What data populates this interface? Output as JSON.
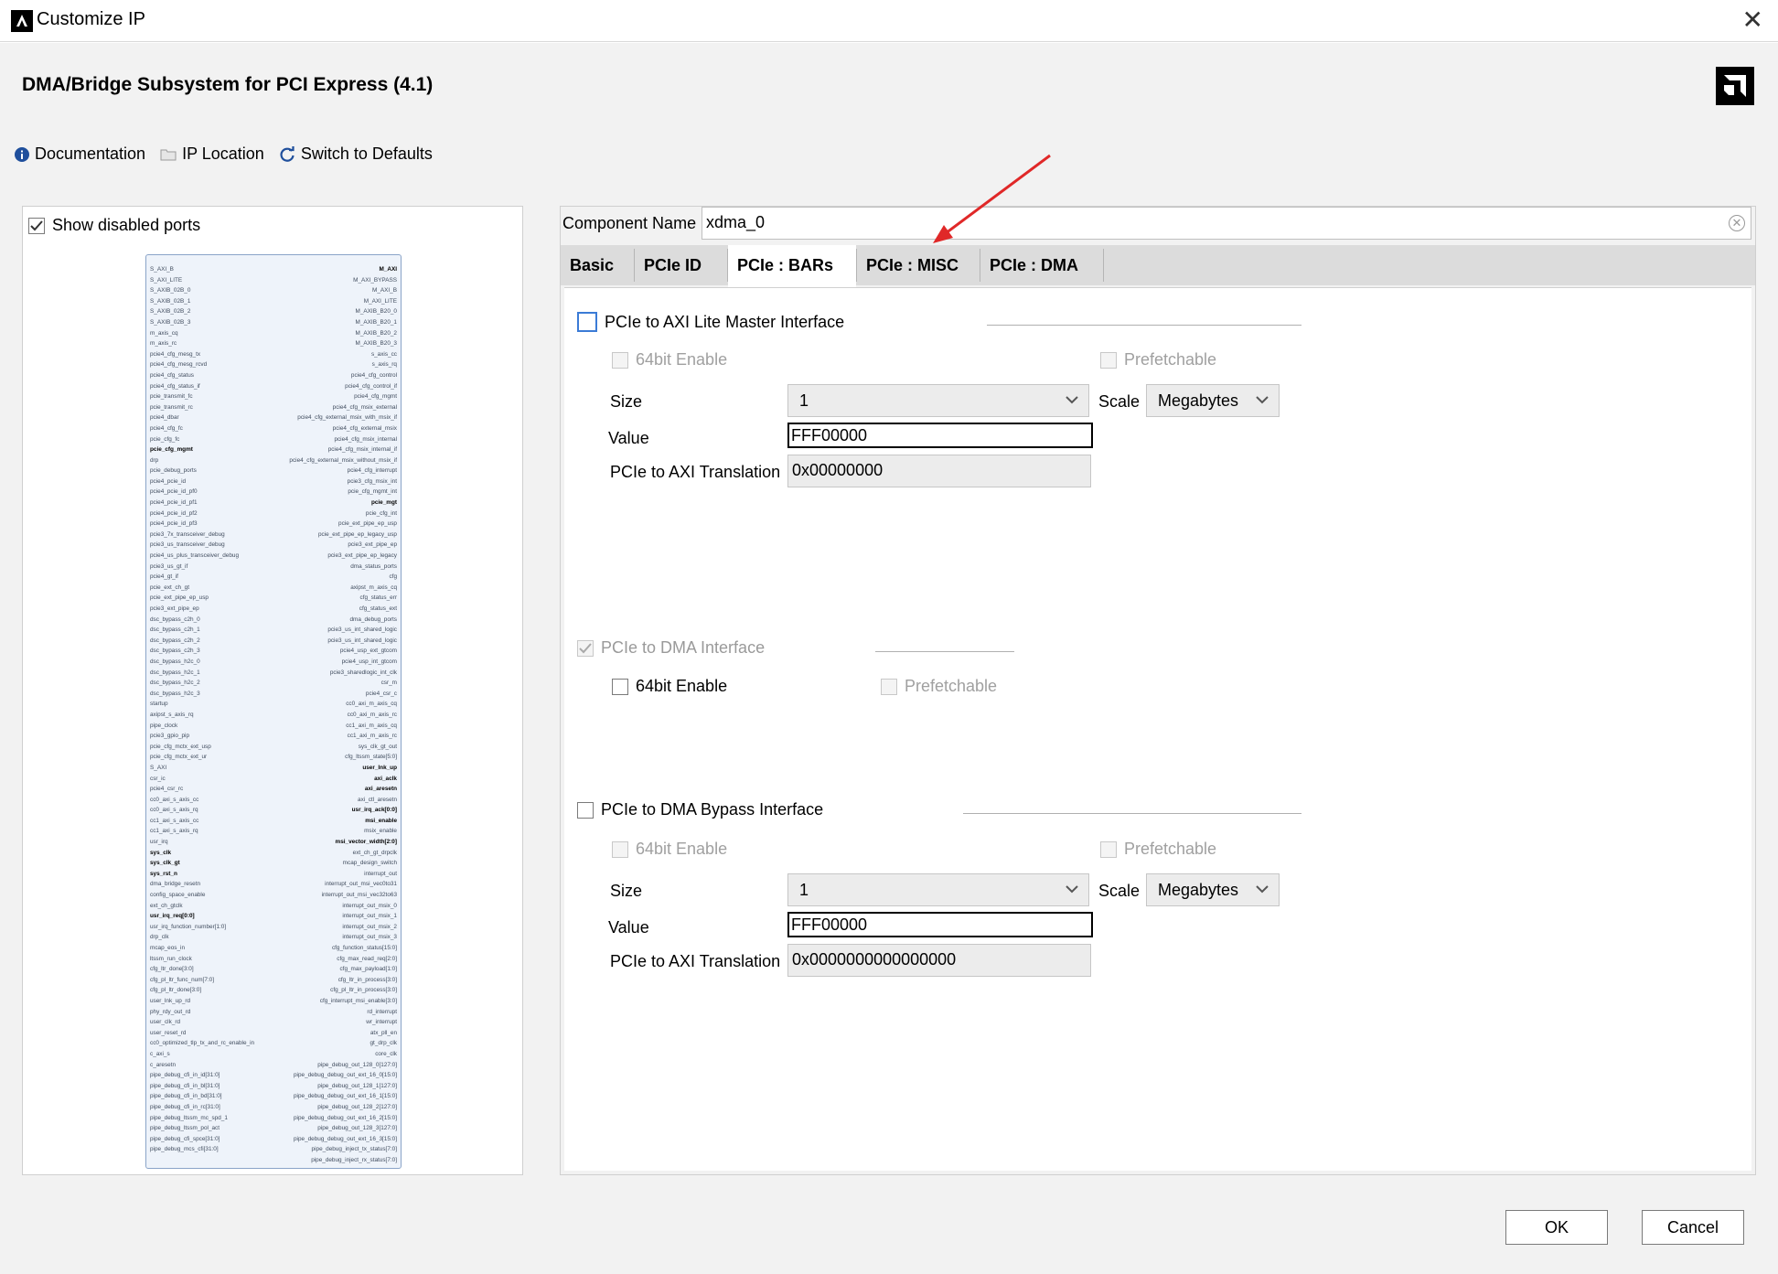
{
  "window": {
    "title": "Customize IP"
  },
  "header": {
    "ip_title": "DMA/Bridge Subsystem for PCI Express (4.1)",
    "toolbar": {
      "documentation": "Documentation",
      "ip_location": "IP Location",
      "switch_defaults": "Switch to Defaults"
    }
  },
  "left_panel": {
    "show_disabled_label": "Show disabled ports",
    "show_disabled_checked": true,
    "left_ports": [
      "S_AXI_B",
      "S_AXI_LITE",
      "S_AXIB_02B_0",
      "S_AXIB_02B_1",
      "S_AXIB_02B_2",
      "S_AXIB_02B_3",
      "m_axis_cq",
      "m_axis_rc",
      "pcie4_cfg_mesg_tx",
      "pcie4_cfg_mesg_rcvd",
      "pcie4_cfg_status",
      "pcie4_cfg_status_if",
      "pcie_transmit_fc",
      "pcie_transmit_rc",
      "pcie4_dbar",
      "pcie4_cfg_fc",
      "pcie_cfg_fc",
      "pcie_cfg_mgmt",
      "drp",
      "pcie_debug_ports",
      "pcie4_pcie_id",
      "pcie4_pcie_id_pf0",
      "pcie4_pcie_id_pf1",
      "pcie4_pcie_id_pf2",
      "pcie4_pcie_id_pf3",
      "pcie3_7x_transceiver_debug",
      "pcie3_us_transceiver_debug",
      "pcie4_us_plus_transceiver_debug",
      "pcie3_us_gt_if",
      "pcie4_gt_if",
      "pcie_ext_ch_gt",
      "pcie_ext_pipe_ep_usp",
      "pcie3_ext_pipe_ep",
      "dsc_bypass_c2h_0",
      "dsc_bypass_c2h_1",
      "dsc_bypass_c2h_2",
      "dsc_bypass_c2h_3",
      "dsc_bypass_h2c_0",
      "dsc_bypass_h2c_1",
      "dsc_bypass_h2c_2",
      "dsc_bypass_h2c_3",
      "startup",
      "axipst_s_axis_rq",
      "pipe_clock",
      "pcie3_gpio_pip",
      "pcie_cfg_mctx_ext_usp",
      "pcie_cfg_mctx_ext_ur",
      "S_AXI",
      "csr_ic",
      "pcie4_csr_rc",
      "cc0_axi_s_axis_cc",
      "cc0_axi_s_axis_rq",
      "cc1_axi_s_axis_cc",
      "cc1_axi_s_axis_rq",
      "usr_irq",
      "sys_clk",
      "sys_clk_gt",
      "sys_rst_n",
      "dma_bridge_resetn",
      "config_space_enable",
      "ext_ch_gtclk",
      "usr_irq_req[0:0]",
      "usr_irq_function_number[1:0]",
      "drp_clk",
      "mcap_eos_in",
      "ltssm_run_clock",
      "cfg_ltr_done[3:0]",
      "cfg_pl_ltr_func_num[7:0]",
      "cfg_pl_ltr_done[3:0]",
      "user_lnk_up_rd",
      "phy_rdy_out_rd",
      "user_clk_rd",
      "user_reset_rd",
      "cc0_optimized_tlp_tx_and_rc_enable_in",
      "c_axi_s",
      "c_aresetn",
      "pipe_debug_cfi_in_id[31:0]",
      "pipe_debug_cfi_in_bl[31:0]",
      "pipe_debug_cfi_in_bd[31:0]",
      "pipe_debug_cfi_in_rc[31:0]",
      "pipe_debug_ltssm_mc_spd_1",
      "pipe_debug_ltssm_pol_act",
      "pipe_debug_cfi_spce[31:0]",
      "pipe_debug_mcs_cfi[31:0]"
    ],
    "right_ports": [
      "M_AXI",
      "M_AXI_BYPASS",
      "M_AXI_B",
      "M_AXI_LITE",
      "M_AXIB_B20_0",
      "M_AXIB_B20_1",
      "M_AXIB_B20_2",
      "M_AXIB_B20_3",
      "s_axis_cc",
      "s_axis_rq",
      "pcie4_cfg_control",
      "pcie4_cfg_control_if",
      "pcie4_cfg_mgmt",
      "pcie4_cfg_msix_external",
      "pcie4_cfg_external_msix_with_msix_if",
      "pcie4_cfg_external_msix",
      "pcie4_cfg_msix_internal",
      "pcie4_cfg_msix_internal_if",
      "pcie4_cfg_external_msix_without_msix_if",
      "pcie4_cfg_interrupt",
      "pcie3_cfg_msix_int",
      "pcie_cfg_mgmt_int",
      "pcie_mgt",
      "pcie_cfg_int",
      "pcie_ext_pipe_ep_usp",
      "pcie_ext_pipe_ep_legacy_usp",
      "pcie3_ext_pipe_ep",
      "pcie3_ext_pipe_ep_legacy",
      "dma_status_ports",
      "cfg",
      "axipst_m_axis_cq",
      "cfg_status_err",
      "cfg_status_ext",
      "dma_debug_ports",
      "pcie3_us_int_shared_logic",
      "pcie3_us_int_shared_logic",
      "pcie4_usp_ext_gtcom",
      "pcie4_usp_int_gtcom",
      "pcie3_sharedlogic_int_clk",
      "csr_m",
      "pcie4_csr_c",
      "cc0_axi_m_axis_cq",
      "cc0_axi_m_axis_rc",
      "cc1_axi_m_axis_cq",
      "cc1_axi_m_axis_rc",
      "sys_clk_gt_out",
      "cfg_ltssm_state[5:0]",
      "user_lnk_up",
      "axi_aclk",
      "axi_aresetn",
      "axi_ctl_aresetn",
      "usr_irq_ack[0:0]",
      "msi_enable",
      "msix_enable",
      "msi_vector_width[2:0]",
      "ext_ch_gt_drpclk",
      "mcap_design_switch",
      "interrupt_out",
      "interrupt_out_msi_vec0to31",
      "interrupt_out_msi_vec32to63",
      "interrupt_out_msix_0",
      "interrupt_out_msix_1",
      "interrupt_out_msix_2",
      "interrupt_out_msix_3",
      "cfg_function_status[15:0]",
      "cfg_max_read_req[2:0]",
      "cfg_max_payload[1:0]",
      "cfg_ltr_in_process[3:0]",
      "cfg_pl_ltr_in_process[3:0]",
      "cfg_interrupt_msi_enable[3:0]",
      "rd_interrupt",
      "wr_interrupt",
      "atx_pll_en",
      "gt_drp_clk",
      "core_clk",
      "pipe_debug_out_128_0[127:0]",
      "pipe_debug_debug_out_ext_16_0[15:0]",
      "pipe_debug_out_128_1[127:0]",
      "pipe_debug_debug_out_ext_16_1[15:0]",
      "pipe_debug_out_128_2[127:0]",
      "pipe_debug_debug_out_ext_16_2[15:0]",
      "pipe_debug_out_128_3[127:0]",
      "pipe_debug_debug_out_ext_16_3[15:0]",
      "pipe_debug_inject_tx_status[7:0]",
      "pipe_debug_inject_rx_status[7:0]"
    ],
    "bold_ports": [
      "pcie_cfg_mgmt",
      "sys_clk",
      "sys_clk_gt",
      "sys_rst_n",
      "usr_irq_req[0:0]",
      "M_AXI",
      "pcie_mgt",
      "user_lnk_up",
      "axi_aclk",
      "axi_aresetn",
      "usr_irq_ack[0:0]",
      "msi_enable",
      "msi_vector_width[2:0]"
    ]
  },
  "component": {
    "label": "Component Name",
    "value": "xdma_0"
  },
  "tabs": [
    {
      "label": "Basic",
      "active": false
    },
    {
      "label": "PCIe ID",
      "active": false
    },
    {
      "label": "PCIe : BARs",
      "active": true
    },
    {
      "label": "PCIe : MISC",
      "active": false
    },
    {
      "label": "PCIe : DMA",
      "active": false
    }
  ],
  "sections": {
    "axi_lite": {
      "title": "PCIe to AXI Lite Master Interface",
      "checked": false,
      "enable_64bit": "64bit Enable",
      "prefetchable": "Prefetchable",
      "size_label": "Size",
      "size_value": "1",
      "scale_label": "Scale",
      "scale_value": "Megabytes",
      "value_label": "Value",
      "value": "FFF00000",
      "translation_label": "PCIe to AXI Translation",
      "translation": "0x00000000"
    },
    "dma": {
      "title": "PCIe to DMA Interface",
      "checked": true,
      "enable_64bit": "64bit Enable",
      "prefetchable": "Prefetchable"
    },
    "bypass": {
      "title": "PCIe to DMA Bypass Interface",
      "checked": false,
      "enable_64bit": "64bit Enable",
      "prefetchable": "Prefetchable",
      "size_label": "Size",
      "size_value": "1",
      "scale_label": "Scale",
      "scale_value": "Megabytes",
      "value_label": "Value",
      "value": "FFF00000",
      "translation_label": "PCIe to AXI Translation",
      "translation": "0x0000000000000000"
    }
  },
  "footer": {
    "ok": "OK",
    "cancel": "Cancel"
  },
  "colors": {
    "annotation_arrow": "#e02828",
    "focus_blue": "#3b7bd6"
  }
}
